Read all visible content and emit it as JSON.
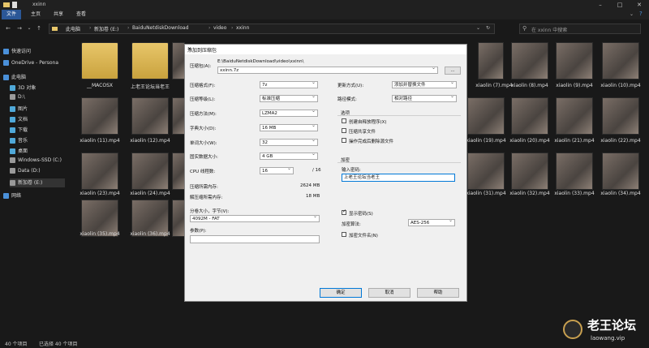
{
  "window": {
    "title": "xxinn"
  },
  "ribbon": {
    "tabs": [
      "文件",
      "主页",
      "共享",
      "查看"
    ]
  },
  "address": {
    "crumbs": [
      "此电脑",
      "新加卷 (E:)",
      "BaiduNetdiskDownload",
      "video",
      "xxinn"
    ],
    "search_placeholder": "在 xxinn 中搜索"
  },
  "nav": {
    "items": [
      {
        "label": "快速访问",
        "color": "#4a90d9"
      },
      {
        "label": "OneDrive - Persona",
        "color": "#4a90d9"
      },
      {
        "label": "此电脑",
        "color": "#4a90d9"
      },
      {
        "label": "3D 对象",
        "color": "#4fa8d8"
      },
      {
        "label": "D:\\",
        "color": "#9a9a9a"
      },
      {
        "label": "图片",
        "color": "#4fa8d8"
      },
      {
        "label": "文档",
        "color": "#4fa8d8"
      },
      {
        "label": "下载",
        "color": "#4fa8d8"
      },
      {
        "label": "音乐",
        "color": "#4fa8d8"
      },
      {
        "label": "桌面",
        "color": "#4fa8d8"
      },
      {
        "label": "Windows-SSD (C:)",
        "color": "#9a9a9a"
      },
      {
        "label": "Data (D:)",
        "color": "#9a9a9a"
      },
      {
        "label": "新加卷 (E:)",
        "color": "#9a9a9a"
      },
      {
        "label": "网络",
        "color": "#4a90d9"
      }
    ]
  },
  "files": {
    "row1": [
      "__MACOSX",
      "上老王论坛当老王",
      "",
      "",
      "",
      "",
      "",
      "",
      "",
      "xiaolin (7).mp4",
      "xiaolin (8).mp4",
      "xiaolin (9).mp4",
      "xiaolin (10).mp4"
    ],
    "row2": [
      "xiaolin (11).mp4",
      "xiaolin (12).mp4",
      "",
      "",
      "",
      "",
      "",
      "",
      "xiaolin (19).mp4",
      "xiaolin (20).mp4",
      "xiaolin (21).mp4",
      "xiaolin (22).mp4"
    ],
    "row3": [
      "xiaolin (23).mp4",
      "xiaolin (24).mp4",
      "",
      "",
      "",
      "",
      "",
      "",
      "xiaolin (31).mp4",
      "xiaolin (32).mp4",
      "xiaolin (33).mp4",
      "xiaolin (34).mp4"
    ],
    "row4": [
      "xiaolin (35).mp4",
      "xiaolin (36).mp4"
    ]
  },
  "status": {
    "count": "40 个项目",
    "selected": "已选择 40 个项目"
  },
  "watermark": {
    "big": "老王论坛",
    "small": "laowang.vip"
  },
  "dialog": {
    "title": "添加到压缩包",
    "archive_label": "压缩包(A):",
    "archive_path": "E:\\BaiduNetdiskDownload\\video\\xxinn\\",
    "archive_name": "xxinn.7z",
    "browse": "...",
    "format_label": "压缩格式(F):",
    "format_value": "7z",
    "level_label": "压缩等级(L):",
    "level_value": "标准压缩",
    "method_label": "压缩方法(M):",
    "method_value": "LZMA2",
    "dict_label": "字典大小(D):",
    "dict_value": "16 MB",
    "word_label": "单词大小(W):",
    "word_value": "32",
    "solid_label": "固实数据大小:",
    "solid_value": "4 GB",
    "cpu_label": "CPU 线程数:",
    "cpu_value": "16",
    "cpu_total": "/ 16",
    "mem_comp_label": "压缩所需内存:",
    "mem_comp_value": "2624 MB",
    "mem_decomp_label": "解压缩所需内存:",
    "mem_decomp_value": "18 MB",
    "split_label": "分卷大小，字节(V):",
    "split_value": "4092M - FAT",
    "params_label": "参数(P):",
    "params_value": "",
    "update_label": "更新方式(U):",
    "update_value": "添加并替换文件",
    "path_label": "路径模式:",
    "path_value": "相对路径",
    "options_label": "选项",
    "opt_sfx": "创建自释放程序(X)",
    "opt_shared": "压缩共享文件",
    "opt_delete": "操作完成后删除源文件",
    "encrypt_label": "加密",
    "password_label": "输入密码:",
    "password_value": "上老王论坛当老王",
    "show_password": "显示密码(S)",
    "enc_method_label": "加密算法:",
    "enc_method_value": "AES-256",
    "enc_names": "加密文件名(N)",
    "ok": "确定",
    "cancel": "取消",
    "help": "帮助"
  }
}
